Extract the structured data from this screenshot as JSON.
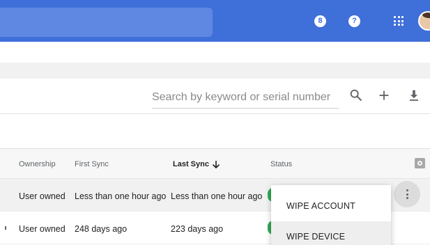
{
  "header": {
    "badge_text": "8",
    "help_text": "?",
    "icons": [
      "hourglass-badge-icon",
      "help-icon",
      "apps-grid-icon",
      "avatar"
    ],
    "brand_color": "#3f6fd8"
  },
  "search": {
    "placeholder": "Search by keyword or serial number"
  },
  "toolbar": {
    "icons": [
      "search-icon",
      "add-icon",
      "download-icon"
    ]
  },
  "table": {
    "columns": {
      "ownership": "Ownership",
      "first_sync": "First Sync",
      "last_sync": "Last Sync",
      "status": "Status"
    },
    "sorted_column": "last_sync",
    "sort_direction": "descending",
    "rows": [
      {
        "ownership": "User owned",
        "first_sync": "Less than one hour ago",
        "last_sync": "Less than one hour ago",
        "status_color": "#34a853"
      },
      {
        "ownership": "User owned",
        "first_sync": "248 days ago",
        "last_sync": "223 days ago",
        "status_color": "#34a853"
      }
    ]
  },
  "context_menu": {
    "items": [
      "WIPE ACCOUNT",
      "WIPE DEVICE"
    ],
    "highlighted": "WIPE DEVICE"
  }
}
